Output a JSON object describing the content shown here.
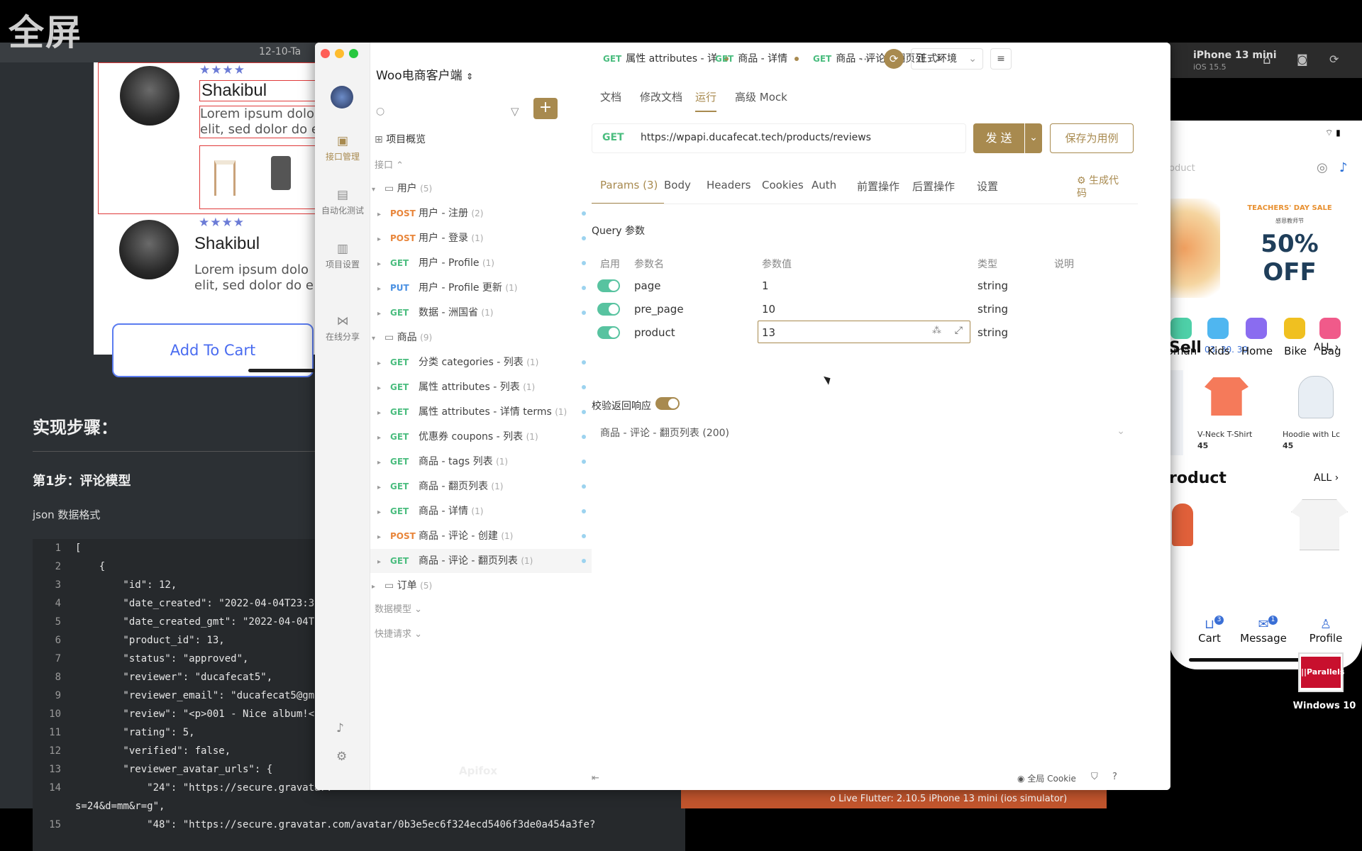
{
  "banner": "全屏",
  "background_window": {
    "title": "12-10-Ta",
    "preview": {
      "reviews": [
        {
          "name": "Shakibul",
          "stars": "★★★★",
          "lorem1": "Lorem ipsum dolo",
          "lorem2": "elit, sed  dolor do e"
        },
        {
          "name": "Shakibul",
          "stars": "★★★★",
          "lorem1": "Lorem ipsum dolo",
          "lorem2": "elit, sed  dolor do e"
        }
      ],
      "add_to_cart": "Add To Cart"
    },
    "heading": "实现步骤：",
    "step": "第1步：评论模型",
    "json_label": "json 数据格式",
    "code": [
      {
        "n": "1",
        "t": "["
      },
      {
        "n": "2",
        "t": "    {"
      },
      {
        "n": "3",
        "t": "        \"id\": 12,"
      },
      {
        "n": "4",
        "t": "        \"date_created\": \"2022-04-04T23:36:2"
      },
      {
        "n": "5",
        "t": "        \"date_created_gmt\": \"2022-04-04T15"
      },
      {
        "n": "6",
        "t": "        \"product_id\": 13,"
      },
      {
        "n": "7",
        "t": "        \"status\": \"approved\","
      },
      {
        "n": "8",
        "t": "        \"reviewer\": \"ducafecat5\","
      },
      {
        "n": "9",
        "t": "        \"reviewer_email\": \"ducafecat5@gmail"
      },
      {
        "n": "10",
        "t": "        \"review\": \"<p>001 - Nice album!</p"
      },
      {
        "n": "11",
        "t": "        \"rating\": 5,"
      },
      {
        "n": "12",
        "t": "        \"verified\": false,"
      },
      {
        "n": "13",
        "t": "        \"reviewer_avatar_urls\": {"
      },
      {
        "n": "14",
        "t": "            \"24\": \"https://secure.gravatar."
      },
      {
        "n": "",
        "t": "s=24&d=mm&r=g\","
      },
      {
        "n": "15",
        "t": "            \"48\": \"https://secure.gravatar.com/avatar/0b3e5ec6f324ecd5406f3de0a454a3fe?"
      }
    ],
    "status_bar": "o Live   Flutter: 2.10.5   iPhone 13 mini (ios simulator)"
  },
  "phone": {
    "title": "iPhone 13 mini",
    "subtitle": "iOS 15.5",
    "search_placeholder": "oduct",
    "sale_top": "TEACHERS' DAY SALE",
    "sale_sub": "感恩教师节",
    "sale_pct": "50%",
    "sale_off": "OFF",
    "categories": [
      "oman",
      "Kids",
      "Home",
      "Bike",
      "Bag"
    ],
    "sell_title": "Sell",
    "sell_date": "03. 30. 30",
    "all_label": "ALL",
    "products": [
      {
        "name": "V-Neck T-Shirt",
        "price": "45"
      },
      {
        "name": "Hoodie with Lc",
        "price": "45"
      }
    ],
    "product_title": "roduct",
    "nav": [
      {
        "label": "Cart",
        "badge": "3"
      },
      {
        "label": "Message",
        "badge": "1"
      },
      {
        "label": "Profile",
        "badge": ""
      }
    ]
  },
  "desktop_icon": {
    "label": "Windows 10",
    "logo_text": "||Parallels"
  },
  "apifox": {
    "project_name": "Woo电商客户端",
    "rail": [
      {
        "label": "接口管理",
        "icon": "api-icon"
      },
      {
        "label": "自动化测试",
        "icon": "test-icon"
      },
      {
        "label": "项目设置",
        "icon": "settings-icon"
      },
      {
        "label": "在线分享",
        "icon": "share-icon"
      }
    ],
    "sidebar": {
      "overview": "项目概览",
      "section_api": "接口",
      "section_models": "数据模型",
      "section_quick": "快捷请求",
      "watermark": "Apifox",
      "tree": [
        {
          "kind": "folder",
          "label": "用户",
          "count": "(5)"
        },
        {
          "kind": "item",
          "method": "POST",
          "label": "用户 - 注册",
          "count": "(2)"
        },
        {
          "kind": "item",
          "method": "POST",
          "label": "用户 - 登录",
          "count": "(1)"
        },
        {
          "kind": "item",
          "method": "GET",
          "label": "用户 - Profile",
          "count": "(1)"
        },
        {
          "kind": "item",
          "method": "PUT",
          "label": "用户 - Profile 更新",
          "count": "(1)"
        },
        {
          "kind": "item",
          "method": "GET",
          "label": "数据 - 洲国省",
          "count": "(1)"
        },
        {
          "kind": "folder",
          "label": "商品",
          "count": "(9)"
        },
        {
          "kind": "item",
          "method": "GET",
          "label": "分类 categories - 列表",
          "count": "(1)"
        },
        {
          "kind": "item",
          "method": "GET",
          "label": "属性 attributes - 列表",
          "count": "(1)"
        },
        {
          "kind": "item",
          "method": "GET",
          "label": "属性 attributes - 详情 terms",
          "count": "(1)"
        },
        {
          "kind": "item",
          "method": "GET",
          "label": "优惠券 coupons - 列表",
          "count": "(1)"
        },
        {
          "kind": "item",
          "method": "GET",
          "label": "商品 - tags 列表",
          "count": "(1)"
        },
        {
          "kind": "item",
          "method": "GET",
          "label": "商品 - 翻页列表",
          "count": "(1)"
        },
        {
          "kind": "item",
          "method": "GET",
          "label": "商品 - 详情",
          "count": "(1)"
        },
        {
          "kind": "item",
          "method": "POST",
          "label": "商品 - 评论 - 创建",
          "count": "(1)"
        },
        {
          "kind": "item",
          "method": "GET",
          "label": "商品 - 评论 - 翻页列表",
          "count": "(1)",
          "selected": true
        },
        {
          "kind": "folder-closed",
          "label": "订单",
          "count": "(5)"
        }
      ]
    },
    "tabs": [
      {
        "method": "GET",
        "label": "属性 attributes - 详"
      },
      {
        "method": "GET",
        "label": "商品 - 详情"
      },
      {
        "method": "GET",
        "label": "商品 - 评论 - 翻页列"
      }
    ],
    "more": "···",
    "environment": "正式环境",
    "subtabs": [
      "文档",
      "修改文档",
      "运行",
      "高级 Mock"
    ],
    "active_subtab": "运行",
    "request": {
      "method": "GET",
      "url": "https://wpapi.ducafecat.tech/products/reviews",
      "send": "发 送",
      "save_case": "保存为用例"
    },
    "param_tabs": [
      "Params (3)",
      "Body",
      "Headers",
      "Cookies",
      "Auth",
      "前置操作",
      "后置操作",
      "设置"
    ],
    "gen_code": "生成代码",
    "query_title": "Query 参数",
    "query_headers": {
      "enable": "启用",
      "name": "参数名",
      "value": "参数值",
      "type": "类型",
      "desc": "说明"
    },
    "query_rows": [
      {
        "name": "page",
        "value": "1",
        "type": "string"
      },
      {
        "name": "pre_page",
        "value": "10",
        "type": "string"
      },
      {
        "name": "product",
        "value": "13",
        "type": "string"
      }
    ],
    "validate_label": "校验返回响应",
    "response_case": "商品 - 评论 - 翻页列表 (200)",
    "footer_cookie": "全局 Cookie"
  },
  "colors": {
    "accent": "#a88a4f",
    "get": "#4bbd7f",
    "post": "#e8853a",
    "put": "#4a90e2",
    "toggle": "#58c3a0"
  }
}
